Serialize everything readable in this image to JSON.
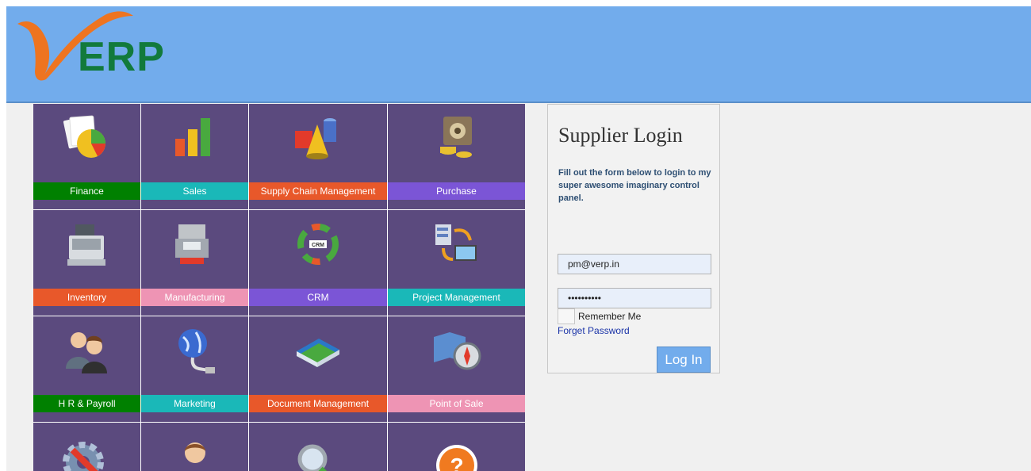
{
  "brand": {
    "logo_text": "ERP",
    "colors": {
      "header": "#72acec",
      "logo_green": "#127a3c",
      "logo_orange": "#ee7420"
    }
  },
  "modules": [
    {
      "label": "Finance",
      "icon": "finance-chart-icon",
      "color": "#008000"
    },
    {
      "label": "Sales",
      "icon": "sales-bar-chart-icon",
      "color": "#1ab8b8"
    },
    {
      "label": "Supply Chain Management",
      "icon": "supply-chain-shapes-icon",
      "color": "#e8582a"
    },
    {
      "label": "Purchase",
      "icon": "purchase-safe-icon",
      "color": "#7b55d6"
    },
    {
      "label": "Inventory",
      "icon": "cash-register-icon",
      "color": "#e8582a"
    },
    {
      "label": "Manufacturing",
      "icon": "manufacturing-machine-icon",
      "color": "#ee94b4"
    },
    {
      "label": "CRM",
      "icon": "crm-cycle-icon",
      "color": "#7b55d6"
    },
    {
      "label": "Project Management",
      "icon": "project-management-icon",
      "color": "#1ab8b8"
    },
    {
      "label": "H R & Payroll",
      "icon": "people-icon",
      "color": "#008000"
    },
    {
      "label": "Marketing",
      "icon": "globe-network-icon",
      "color": "#1ab8b8"
    },
    {
      "label": "Document Management",
      "icon": "books-icon",
      "color": "#e8582a"
    },
    {
      "label": "Point of Sale",
      "icon": "map-compass-icon",
      "color": "#ee94b4"
    },
    {
      "label": "",
      "icon": "settings-gear-icon",
      "color": "#5b4a7e"
    },
    {
      "label": "",
      "icon": "user-person-icon",
      "color": "#5b4a7e"
    },
    {
      "label": "",
      "icon": "search-magnifier-icon",
      "color": "#5b4a7e"
    },
    {
      "label": "",
      "icon": "help-question-icon",
      "color": "#5b4a7e"
    }
  ],
  "login": {
    "title": "Supplier Login",
    "description": "Fill out the form below to login to my super awesome imaginary control panel.",
    "email_value": "pm@verp.in",
    "password_value": "••••••••••",
    "remember_label": "Remember Me",
    "forget_label": "Forget Password",
    "button_label": "Log In"
  }
}
